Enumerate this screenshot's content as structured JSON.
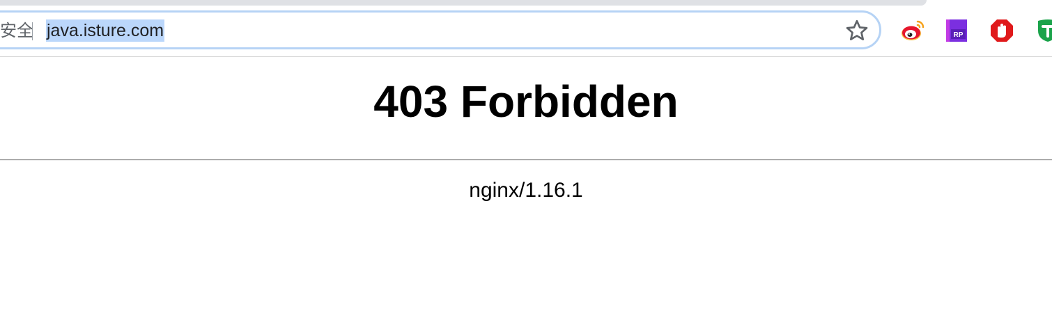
{
  "browser": {
    "address_bar": {
      "security_label": "安全",
      "url": "java.isture.com",
      "url_selected": true,
      "selection_color": "#bbd7fb",
      "focus_ring_color": "#b6d3f5"
    },
    "bookmark_icon": "star-icon",
    "extensions": [
      {
        "name": "weibo-extension-icon",
        "color": "#e6162d"
      },
      {
        "name": "axure-rp-extension-icon",
        "color": "#8a3ffc"
      },
      {
        "name": "adblock-extension-icon",
        "color": "#e0191b"
      },
      {
        "name": "green-shield-extension-icon",
        "color": "#1aa34a"
      }
    ]
  },
  "page": {
    "title": "403 Forbidden",
    "footer": "nginx/1.16.1"
  }
}
